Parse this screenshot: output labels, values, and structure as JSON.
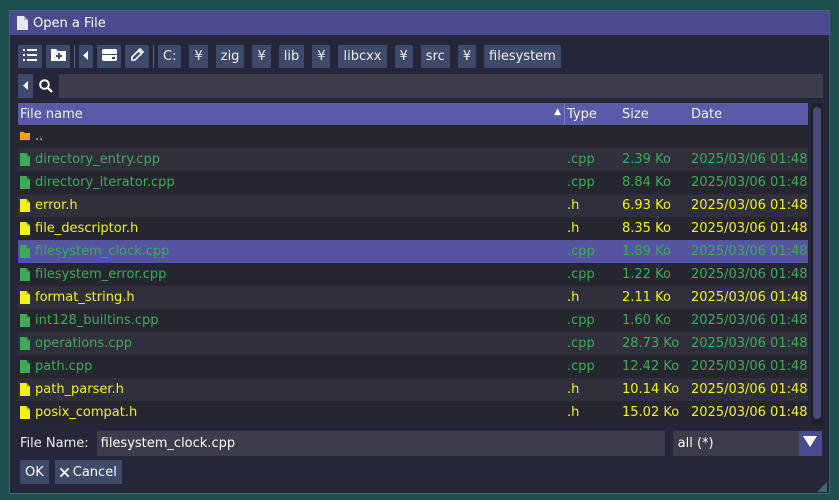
{
  "dialog": {
    "title": "Open a File"
  },
  "toolbar": {
    "buttons": [
      {
        "name": "list-view-button",
        "icon": "list-icon"
      },
      {
        "name": "new-folder-button",
        "icon": "folder-plus-icon"
      },
      {
        "name": "back-button",
        "icon": "caret-left-icon"
      },
      {
        "name": "drives-button",
        "icon": "drive-icon"
      },
      {
        "name": "edit-path-button",
        "icon": "pencil-icon"
      }
    ],
    "path": [
      "C:",
      "¥",
      "zig",
      "¥",
      "lib",
      "¥",
      "libcxx",
      "¥",
      "src",
      "¥",
      "filesystem"
    ]
  },
  "search": {
    "value": "",
    "placeholder": ""
  },
  "table": {
    "headers": {
      "name": "File name",
      "type": "Type",
      "size": "Size",
      "date": "Date"
    },
    "sort": {
      "column": "name",
      "direction": "ascending"
    },
    "rows": [
      {
        "name": "..",
        "type": "",
        "size": "",
        "date": "",
        "kind": "folder",
        "color": "grey"
      },
      {
        "name": "directory_entry.cpp",
        "type": ".cpp",
        "size": "2.39 Ko",
        "date": "2025/03/06 01:48",
        "kind": "file",
        "color": "green"
      },
      {
        "name": "directory_iterator.cpp",
        "type": ".cpp",
        "size": "8.84 Ko",
        "date": "2025/03/06 01:48",
        "kind": "file",
        "color": "green"
      },
      {
        "name": "error.h",
        "type": ".h",
        "size": "6.93 Ko",
        "date": "2025/03/06 01:48",
        "kind": "file",
        "color": "yellow"
      },
      {
        "name": "file_descriptor.h",
        "type": ".h",
        "size": "8.35 Ko",
        "date": "2025/03/06 01:48",
        "kind": "file",
        "color": "yellow"
      },
      {
        "name": "filesystem_clock.cpp",
        "type": ".cpp",
        "size": "1.89 Ko",
        "date": "2025/03/06 01:48",
        "kind": "file",
        "color": "green",
        "selected": true
      },
      {
        "name": "filesystem_error.cpp",
        "type": ".cpp",
        "size": "1.22 Ko",
        "date": "2025/03/06 01:48",
        "kind": "file",
        "color": "green"
      },
      {
        "name": "format_string.h",
        "type": ".h",
        "size": "2.11 Ko",
        "date": "2025/03/06 01:48",
        "kind": "file",
        "color": "yellow"
      },
      {
        "name": "int128_builtins.cpp",
        "type": ".cpp",
        "size": "1.60 Ko",
        "date": "2025/03/06 01:48",
        "kind": "file",
        "color": "green"
      },
      {
        "name": "operations.cpp",
        "type": ".cpp",
        "size": "28.73 Ko",
        "date": "2025/03/06 01:48",
        "kind": "file",
        "color": "green"
      },
      {
        "name": "path.cpp",
        "type": ".cpp",
        "size": "12.42 Ko",
        "date": "2025/03/06 01:48",
        "kind": "file",
        "color": "green"
      },
      {
        "name": "path_parser.h",
        "type": ".h",
        "size": "10.14 Ko",
        "date": "2025/03/06 01:48",
        "kind": "file",
        "color": "yellow"
      },
      {
        "name": "posix_compat.h",
        "type": ".h",
        "size": "15.02 Ko",
        "date": "2025/03/06 01:48",
        "kind": "file",
        "color": "yellow"
      }
    ]
  },
  "footer": {
    "file_name_label": "File Name:",
    "file_name_value": "filesystem_clock.cpp",
    "filter_value": "all (*)",
    "ok_label": "OK",
    "cancel_label": "Cancel"
  },
  "colors": {
    "cpp_file": "#3faa58",
    "header_file": "#f2f21a",
    "folder": "#f0a020",
    "accent": "#5a5aa8",
    "selection": "#5454a0"
  }
}
